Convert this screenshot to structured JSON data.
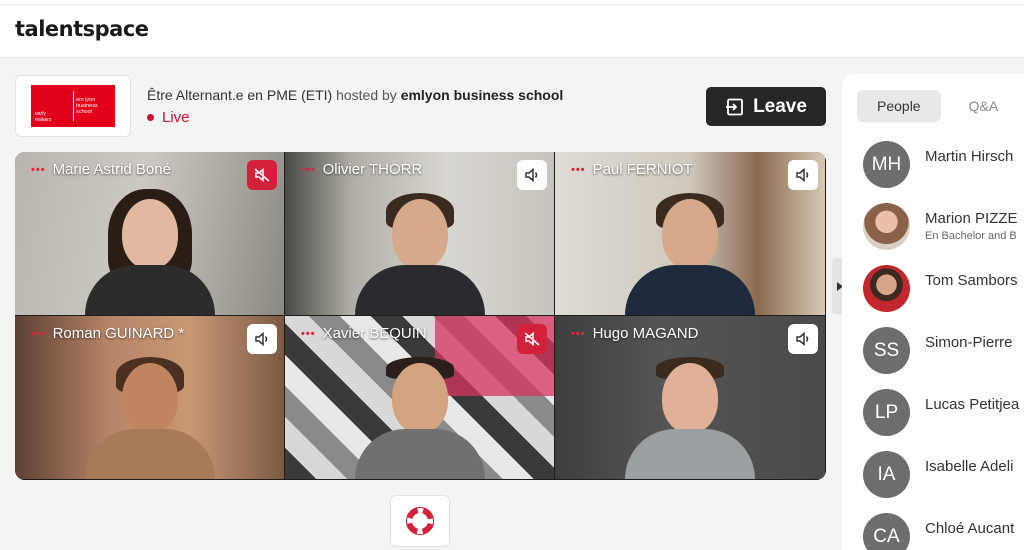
{
  "app": {
    "brand": "talentspace"
  },
  "event": {
    "organizer_logo": {
      "tagline": "early makers",
      "name": "em lyon business school",
      "color": "#e2001a"
    },
    "title": "Être Alternant.e en PME (ETI)",
    "hosted_by_label": "hosted by",
    "host": "emlyon business school",
    "status": "Live",
    "leave_label": "Leave"
  },
  "participants": [
    {
      "name": "Marie Astrid Boné",
      "audio": "muted"
    },
    {
      "name": "Olivier THORR",
      "audio": "on"
    },
    {
      "name": "Paul FERNIOT",
      "audio": "on"
    },
    {
      "name": "Roman GUINARD *",
      "audio": "on"
    },
    {
      "name": "Xavier BEQUIN",
      "audio": "muted"
    },
    {
      "name": "Hugo MAGAND",
      "audio": "on"
    }
  ],
  "sidebar": {
    "tabs": [
      {
        "label": "People"
      },
      {
        "label": "Q&A"
      }
    ],
    "people": [
      {
        "initials": "MH",
        "name": "Martin Hirsch"
      },
      {
        "initials": "",
        "name": "Marion PIZZE",
        "subtitle": "En Bachelor and B"
      },
      {
        "initials": "",
        "name": "Tom Sambors"
      },
      {
        "initials": "SS",
        "name": "Simon-Pierre"
      },
      {
        "initials": "LP",
        "name": "Lucas Petitjea"
      },
      {
        "initials": "IA",
        "name": "Isabelle Adeli"
      },
      {
        "initials": "CA",
        "name": "Chloé Aucant"
      }
    ]
  },
  "colors": {
    "accent": "#c8102e",
    "muted_badge": "#d3213c",
    "leave_button": "#262626"
  },
  "icons": {
    "help": "lifebuoy-icon",
    "audio_on": "speaker-icon",
    "audio_off": "speaker-muted-icon",
    "leave": "exit-icon",
    "collapse": "chevron-right-icon"
  }
}
